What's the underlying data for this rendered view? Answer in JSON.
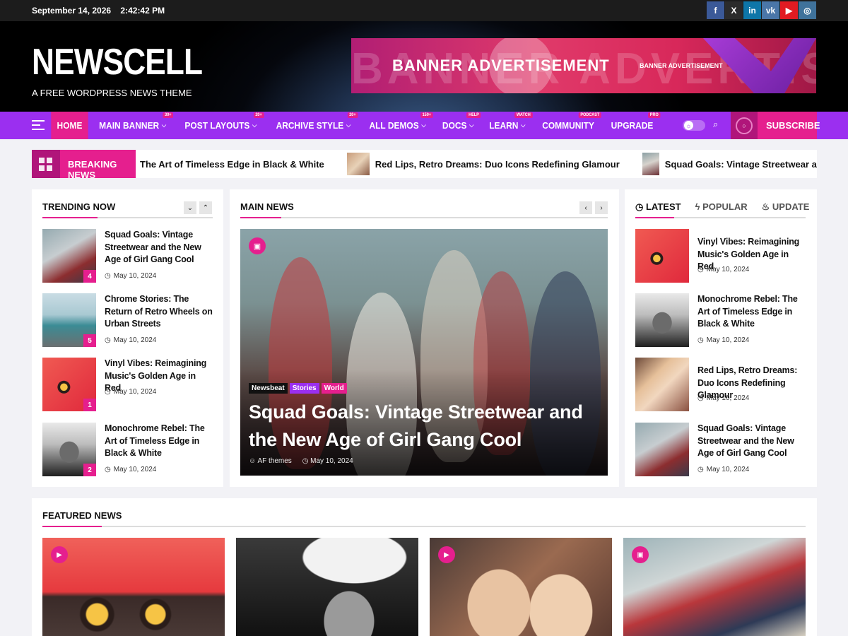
{
  "topbar": {
    "date": "September 14, 2026",
    "time": "2:42:42 PM"
  },
  "socials": [
    {
      "name": "facebook",
      "glyph": "f",
      "color": "#3b5998"
    },
    {
      "name": "x",
      "glyph": "X",
      "color": "#2b2b2b"
    },
    {
      "name": "linkedin",
      "glyph": "in",
      "color": "#0e76a8"
    },
    {
      "name": "vk",
      "glyph": "vk",
      "color": "#4a76a8"
    },
    {
      "name": "youtube",
      "glyph": "▶",
      "color": "#e11b22"
    },
    {
      "name": "instagram",
      "glyph": "◎",
      "color": "#3f729b"
    }
  ],
  "header": {
    "logo": "NEWSCELL",
    "tagline": "A FREE WORDPRESS NEWS THEME",
    "banner": {
      "ghost": "BANNER ADVERTISEME",
      "main": "BANNER ADVERTISEMENT",
      "small": "BANNER ADVERTISEMENT"
    }
  },
  "nav": {
    "items": [
      {
        "label": "HOME",
        "active": true,
        "caret": false,
        "badge": ""
      },
      {
        "label": "MAIN BANNER",
        "active": false,
        "caret": true,
        "badge": "30+"
      },
      {
        "label": "POST LAYOUTS",
        "active": false,
        "caret": true,
        "badge": "20+"
      },
      {
        "label": "ARCHIVE STYLE",
        "active": false,
        "caret": true,
        "badge": "20+"
      },
      {
        "label": "ALL DEMOS",
        "active": false,
        "caret": true,
        "badge": "150+"
      },
      {
        "label": "DOCS",
        "active": false,
        "caret": true,
        "badge": "HELP"
      },
      {
        "label": "LEARN",
        "active": false,
        "caret": true,
        "badge": "WATCH"
      },
      {
        "label": "COMMUNITY",
        "active": false,
        "caret": false,
        "badge": "PODCAST"
      },
      {
        "label": "UPGRADE",
        "active": false,
        "caret": false,
        "badge": "PRO"
      }
    ],
    "subscribe": "SUBSCRIBE"
  },
  "breaking": {
    "label": "BREAKING NEWS",
    "items": [
      "The Art of Timeless Edge in Black & White",
      "Red Lips, Retro Dreams: Duo Icons Redefining Glamour",
      "Squad Goals: Vintage Streetwear and the New Age of Girl Gang Cool"
    ]
  },
  "trending": {
    "title": "TRENDING NOW",
    "items": [
      {
        "title": "Squad Goals: Vintage Streetwear and the New Age of Girl Gang Cool",
        "date": "May 10, 2024",
        "num": "4"
      },
      {
        "title": "Chrome Stories: The Return of Retro Wheels on Urban Streets",
        "date": "May 10, 2024",
        "num": "5"
      },
      {
        "title": "Vinyl Vibes: Reimagining Music's Golden Age in Red",
        "date": "May 10, 2024",
        "num": "1"
      },
      {
        "title": "Monochrome Rebel: The Art of Timeless Edge in Black & White",
        "date": "May 10, 2024",
        "num": "2"
      }
    ]
  },
  "main_news": {
    "title": "MAIN NEWS",
    "tags": [
      "Newsbeat",
      "Stories",
      "World"
    ],
    "headline": "Squad Goals: Vintage Streetwear and the New Age of Girl Gang Cool",
    "author": "AF themes",
    "date": "May 10, 2024"
  },
  "latest": {
    "tabs": [
      "LATEST",
      "POPULAR",
      "UPDATE"
    ],
    "items": [
      {
        "title": "Vinyl Vibes: Reimagining Music's Golden Age in Red",
        "date": "May 10, 2024"
      },
      {
        "title": "Monochrome Rebel: The Art of Timeless Edge in Black & White",
        "date": "May 10, 2024"
      },
      {
        "title": "Red Lips, Retro Dreams: Duo Icons Redefining Glamour",
        "date": "May 10, 2024"
      },
      {
        "title": "Squad Goals: Vintage Streetwear and the New Age of Girl Gang Cool",
        "date": "May 10, 2024"
      }
    ]
  },
  "featured": {
    "title": "FEATURED NEWS"
  },
  "colors": {
    "accent": "#e51f8e",
    "nav": "#9b2ff0"
  }
}
